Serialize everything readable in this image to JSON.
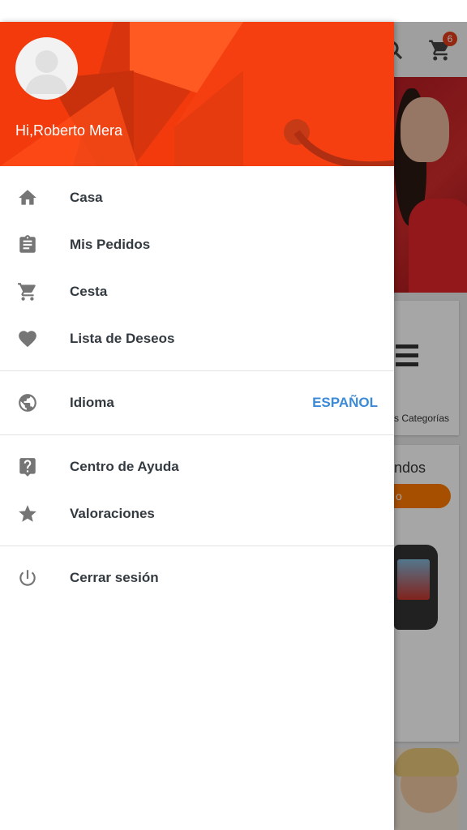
{
  "background_app": {
    "cart_badge": "6",
    "categories_label": "s Categorías",
    "card_title_fragment": "ndos",
    "button_fragment": "o"
  },
  "drawer": {
    "greeting": "Hi,Roberto Mera",
    "sections": [
      [
        {
          "label": "Casa",
          "icon": "home-icon"
        },
        {
          "label": "Mis Pedidos",
          "icon": "clipboard-icon"
        },
        {
          "label": "Cesta",
          "icon": "cart-icon"
        },
        {
          "label": "Lista de Deseos",
          "icon": "heart-icon"
        }
      ],
      [
        {
          "label": "Idioma",
          "icon": "globe-icon",
          "value": "ESPAÑOL"
        }
      ],
      [
        {
          "label": "Centro de Ayuda",
          "icon": "help-icon"
        },
        {
          "label": "Valoraciones",
          "icon": "star-icon"
        }
      ],
      [
        {
          "label": "Cerrar sesión",
          "icon": "power-icon"
        }
      ]
    ]
  },
  "colors": {
    "header": "#f04a13",
    "menu_text": "#333a40",
    "icon": "#757575",
    "language_value": "#3b8ad8"
  }
}
